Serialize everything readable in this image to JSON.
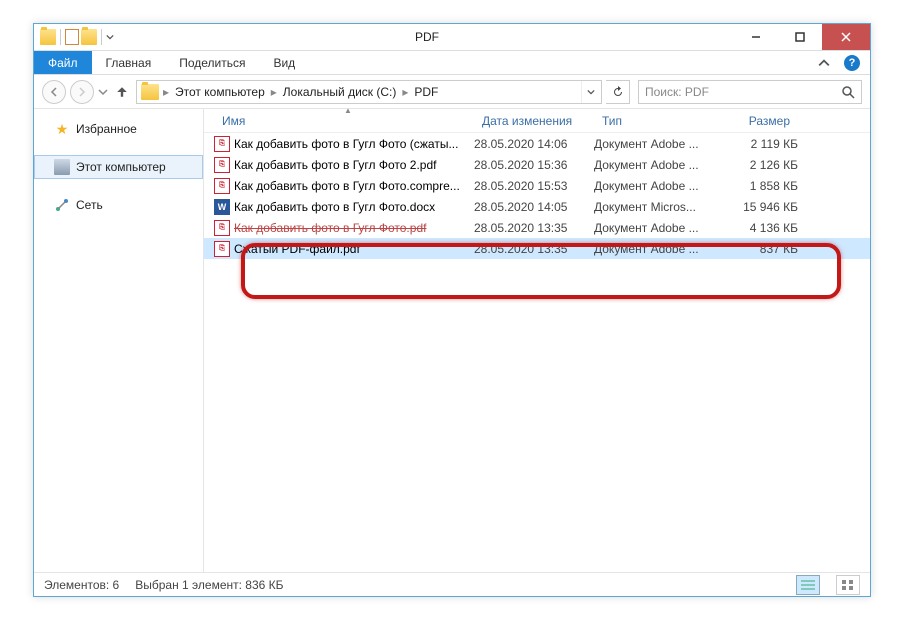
{
  "window": {
    "title": "PDF"
  },
  "ribbon": {
    "file": "Файл",
    "tabs": [
      "Главная",
      "Поделиться",
      "Вид"
    ]
  },
  "breadcrumb": {
    "items": [
      "Этот компьютер",
      "Локальный диск (C:)",
      "PDF"
    ]
  },
  "search": {
    "placeholder": "Поиск: PDF"
  },
  "sidebar": {
    "favorites": "Избранное",
    "computer": "Этот компьютер",
    "network": "Сеть"
  },
  "columns": {
    "name": "Имя",
    "date": "Дата изменения",
    "type": "Тип",
    "size": "Размер"
  },
  "files": [
    {
      "icon": "pdf",
      "name": "Как добавить фото в Гугл Фото (сжаты...",
      "date": "28.05.2020 14:06",
      "type": "Документ Adobe ...",
      "size": "2 119 КБ"
    },
    {
      "icon": "pdf",
      "name": "Как добавить фото в Гугл Фото 2.pdf",
      "date": "28.05.2020 15:36",
      "type": "Документ Adobe ...",
      "size": "2 126 КБ"
    },
    {
      "icon": "pdf",
      "name": "Как добавить фото в Гугл Фото.compre...",
      "date": "28.05.2020 15:53",
      "type": "Документ Adobe ...",
      "size": "1 858 КБ"
    },
    {
      "icon": "docx",
      "name": "Как добавить фото в Гугл Фото.docx",
      "date": "28.05.2020 14:05",
      "type": "Документ Micros...",
      "size": "15 946 КБ"
    },
    {
      "icon": "pdf",
      "name": "Как добавить фото в Гугл Фото.pdf",
      "date": "28.05.2020 13:35",
      "type": "Документ Adobe ...",
      "size": "4 136 КБ",
      "hidden": true
    },
    {
      "icon": "pdf",
      "name": "Сжатый PDF-файл.pdf",
      "date": "28.05.2020 13:35",
      "type": "Документ Adobe ...",
      "size": "837 КБ",
      "selected": true
    }
  ],
  "statusbar": {
    "count": "Элементов: 6",
    "selected": "Выбран 1 элемент: 836 КБ"
  }
}
